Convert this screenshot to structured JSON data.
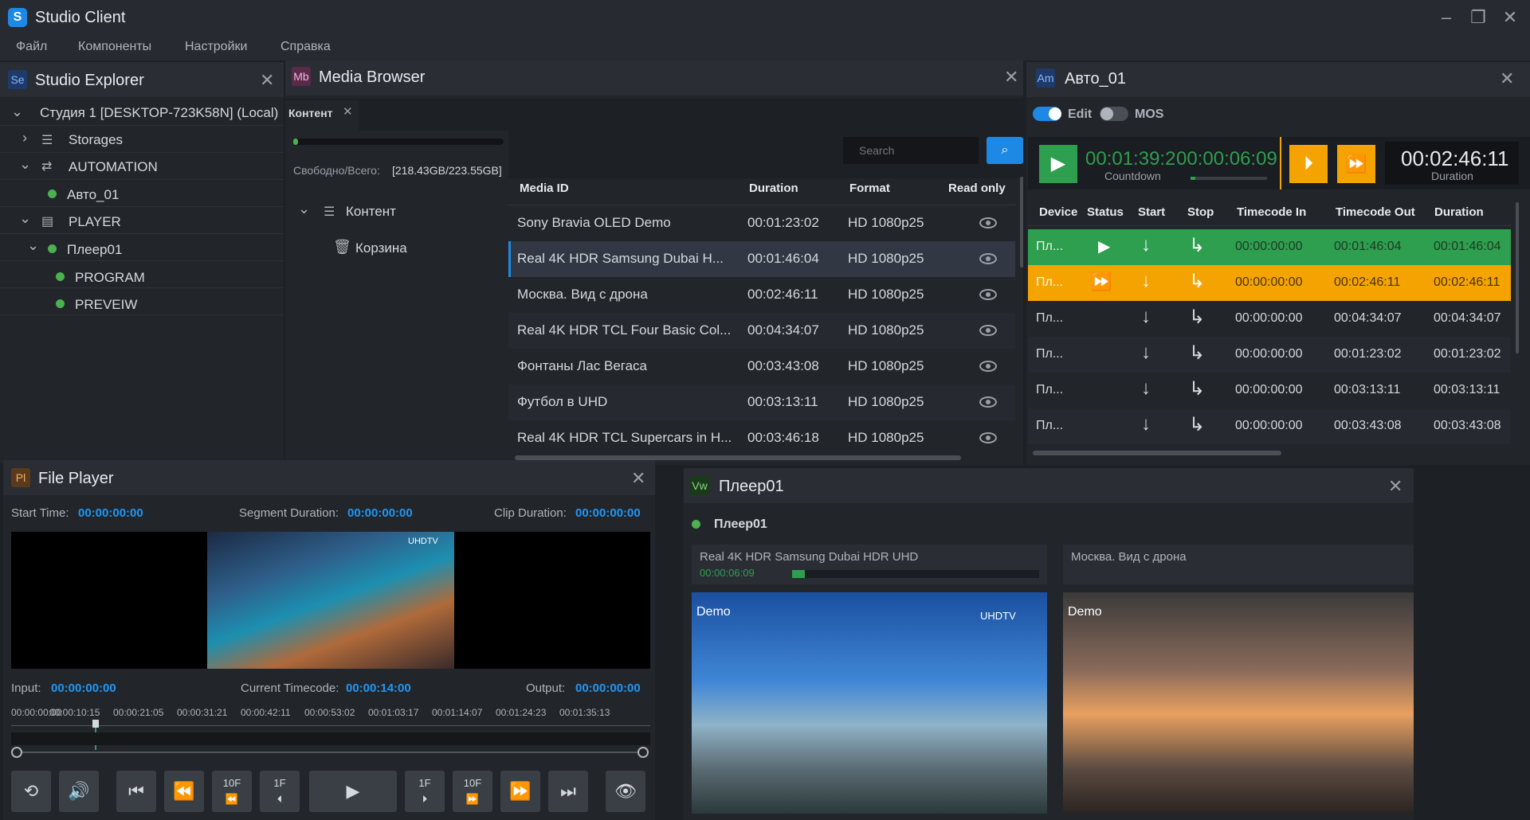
{
  "app": {
    "title": "Studio Client",
    "logo": "S"
  },
  "menu": [
    "Файл",
    "Компоненты",
    "Настройки",
    "Справка"
  ],
  "explorer": {
    "badge": "Se",
    "title": "Studio Explorer",
    "items": [
      {
        "label": "Студия 1 [DESKTOP-723K58N] (Local)"
      },
      {
        "label": "Storages"
      },
      {
        "label": "AUTOMATION"
      },
      {
        "label": "Авто_01"
      },
      {
        "label": "PLAYER"
      },
      {
        "label": "Плеер01"
      },
      {
        "label": "PROGRAM"
      },
      {
        "label": "PREVEIW"
      }
    ]
  },
  "media_browser": {
    "badge": "Mb",
    "title": "Media Browser",
    "tab": "Контент",
    "free_label": "Свободно/Всего:",
    "free_value": "[218.43GB/223.55GB]",
    "tree": [
      "Контент",
      "Корзина"
    ],
    "search_placeholder": "Search",
    "columns": [
      "Media ID",
      "Duration",
      "Format",
      "Read only"
    ],
    "rows": [
      {
        "id": "Sony Bravia OLED Demo",
        "duration": "00:01:23:02",
        "format": "HD 1080p25"
      },
      {
        "id": "Real 4K HDR  Samsung Dubai H...",
        "duration": "00:01:46:04",
        "format": "HD 1080p25"
      },
      {
        "id": "Москва. Вид с дрона",
        "duration": "00:02:46:11",
        "format": "HD 1080p25"
      },
      {
        "id": "Real 4K HDR  TCL Four Basic Col...",
        "duration": "00:04:34:07",
        "format": "HD 1080p25"
      },
      {
        "id": "Фонтаны Лас Вегаса",
        "duration": "00:03:43:08",
        "format": "HD 1080p25"
      },
      {
        "id": "Футбол в UHD",
        "duration": "00:03:13:11",
        "format": "HD 1080p25"
      },
      {
        "id": "Real 4K HDR  TCL Supercars in H...",
        "duration": "00:03:46:18",
        "format": "HD 1080p25"
      }
    ]
  },
  "auto": {
    "badge": "Am",
    "title": "Авто_01",
    "edit_label": "Edit",
    "mos_label": "MOS",
    "countdown_value": "00:01:39:2",
    "countdown_label": "Countdown",
    "elapsed_value": "00:00:06:09",
    "duration_value": "00:02:46:11",
    "duration_label": "Duration",
    "columns": [
      "Device",
      "Status",
      "Start",
      "Stop",
      "Timecode In",
      "Timecode Out",
      "Duration"
    ],
    "rows": [
      {
        "device": "Пл...",
        "tc_in": "00:00:00:00",
        "tc_out": "00:01:46:04",
        "duration": "00:01:46:04",
        "state": "playing"
      },
      {
        "device": "Пл...",
        "tc_in": "00:00:00:00",
        "tc_out": "00:02:46:11",
        "duration": "00:02:46:11",
        "state": "next"
      },
      {
        "device": "Пл...",
        "tc_in": "00:00:00:00",
        "tc_out": "00:04:34:07",
        "duration": "00:04:34:07",
        "state": ""
      },
      {
        "device": "Пл...",
        "tc_in": "00:00:00:00",
        "tc_out": "00:01:23:02",
        "duration": "00:01:23:02",
        "state": ""
      },
      {
        "device": "Пл...",
        "tc_in": "00:00:00:00",
        "tc_out": "00:03:13:11",
        "duration": "00:03:13:11",
        "state": ""
      },
      {
        "device": "Пл...",
        "tc_in": "00:00:00:00",
        "tc_out": "00:03:43:08",
        "duration": "00:03:43:08",
        "state": ""
      }
    ]
  },
  "file_player": {
    "badge": "Pl",
    "title": "File Player",
    "start_label": "Start Time:",
    "start_value": "00:00:00:00",
    "segment_label": "Segment Duration:",
    "segment_value": "00:00:00:00",
    "clip_label": "Clip Duration:",
    "clip_value": "00:00:00:00",
    "input_label": "Input:",
    "input_value": "00:00:00:00",
    "current_label": "Current Timecode:",
    "current_value": "00:00:14:00",
    "output_label": "Output:",
    "output_value": "00:00:00:00",
    "ruler": [
      "00:00:00:00",
      "00:00:10:15",
      "00:00:21:05",
      "00:00:31:21",
      "00:00:42:11",
      "00:00:53:02",
      "00:01:03:17",
      "00:01:14:07",
      "00:01:24:23",
      "00:01:35:13"
    ],
    "buttons": [
      "10F",
      "1F",
      "1F",
      "10F"
    ]
  },
  "viewer": {
    "badge": "Vw",
    "title": "Плеер01",
    "channel": "Плеер01",
    "program_title": "Real 4K HDR  Samsung Dubai HDR UHD",
    "program_time": "00:00:06:09",
    "program_progress": 0.05,
    "preview_title": "Москва. Вид с дрона",
    "demo_label": "Demo",
    "uhd_label": "UHDTV"
  },
  "colors": {
    "accent": "#1e88e5",
    "green": "#2e9e4f",
    "orange": "#f5a300"
  }
}
